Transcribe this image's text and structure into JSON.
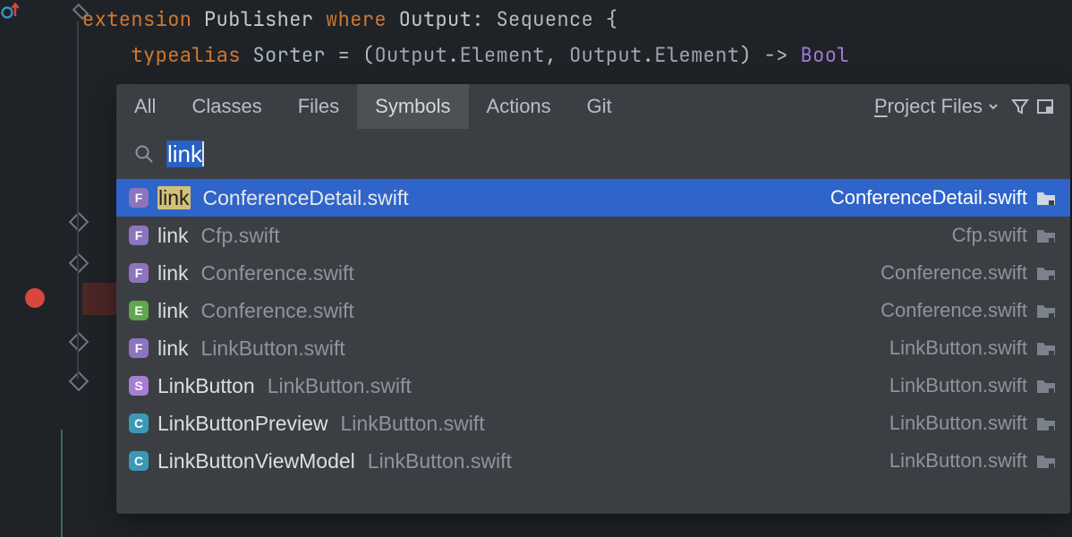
{
  "code": {
    "line1": {
      "a": "extension ",
      "b": "Publisher ",
      "c": "where ",
      "d": "Output",
      "e": ": Sequence {",
      "indent": ""
    },
    "line2": {
      "a": "typealias ",
      "b": "Sorter",
      "c": " = (",
      "d": "Output",
      "e": ".",
      "f": "Element",
      "g": ", ",
      "h": "Output",
      "i": ".",
      "j": "Element",
      "k": ") -> ",
      "l": "Bool",
      "indent": "    "
    }
  },
  "popup": {
    "tabs": [
      "All",
      "Classes",
      "Files",
      "Symbols",
      "Actions",
      "Git"
    ],
    "active_tab_index": 3,
    "scope_prefix": "P",
    "scope_rest": "roject Files",
    "search_query": "link",
    "results": [
      {
        "badge": "F",
        "match": "link",
        "context": "ConferenceDetail.swift",
        "location": "ConferenceDetail.swift",
        "selected": true,
        "hl": true
      },
      {
        "badge": "F",
        "match": "link",
        "context": "Cfp.swift",
        "location": "Cfp.swift",
        "selected": false
      },
      {
        "badge": "F",
        "match": "link",
        "context": "Conference.swift",
        "location": "Conference.swift",
        "selected": false
      },
      {
        "badge": "E",
        "match": "link",
        "context": "Conference.swift",
        "location": "Conference.swift",
        "selected": false
      },
      {
        "badge": "F",
        "match": "link",
        "context": "LinkButton.swift",
        "location": "LinkButton.swift",
        "selected": false
      },
      {
        "badge": "S",
        "match": "LinkButton",
        "context": "LinkButton.swift",
        "location": "LinkButton.swift",
        "selected": false
      },
      {
        "badge": "C",
        "match": "LinkButtonPreview",
        "context": "LinkButton.swift",
        "location": "LinkButton.swift",
        "selected": false
      },
      {
        "badge": "C",
        "match": "LinkButtonViewModel",
        "context": "LinkButton.swift",
        "location": "LinkButton.swift",
        "selected": false
      }
    ]
  }
}
